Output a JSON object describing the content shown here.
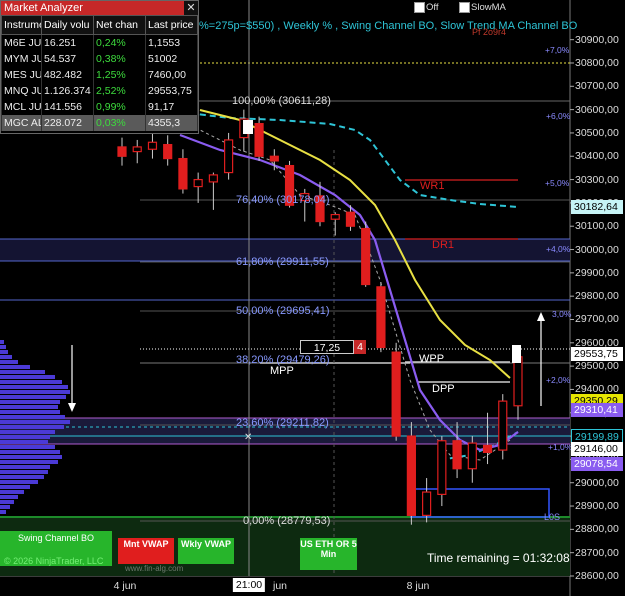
{
  "analyzer": {
    "title": "Market Analyzer",
    "close": "✕",
    "columns": [
      "Instrume",
      "Daily volu",
      "Net chan",
      "Last price"
    ],
    "rows": [
      {
        "instrument": "M6E JU",
        "volume": "16.251",
        "net": "0,24%",
        "last": "1,1553"
      },
      {
        "instrument": "MYM JU",
        "volume": "54.537",
        "net": "0,38%",
        "last": "51002"
      },
      {
        "instrument": "MES JU",
        "volume": "482.482",
        "net": "1,25%",
        "last": "7460,00"
      },
      {
        "instrument": "MNQ JU",
        "volume": "1.126.374",
        "net": "2,52%",
        "last": "29553,75"
      },
      {
        "instrument": "MCL JU",
        "volume": "141.556",
        "net": "0,99%",
        "last": "91,17"
      },
      {
        "instrument": "MGC AL",
        "volume": "228.072",
        "net": "0,03%",
        "last": "4355,3"
      }
    ]
  },
  "header": {
    "strip": "%=275p=$550) , Weekly % , Swing Channel BO, Slow Trend MA Channel BO",
    "off_label": "Off",
    "slowma_label": "SlowMA",
    "top_right_red": "Pf 2o9r4"
  },
  "price_axis": {
    "ticks": [
      "30900,00",
      "30800,00",
      "30700,00",
      "30600,00",
      "30500,00",
      "30400,00",
      "30300,00",
      "30200,00",
      "30100,00",
      "30000,00",
      "29900,00",
      "29800,00",
      "29700,00",
      "29600,00",
      "29500,00",
      "29400,00",
      "29300,00",
      "29200,00",
      "29100,00",
      "29000,00",
      "28900,00",
      "28800,00",
      "28700,00",
      "28600,00"
    ],
    "tags": [
      {
        "label": "30182,64",
        "bg": "#c6f4f6",
        "fg": "#000"
      },
      {
        "label": "29553,75",
        "bg": "#ffffff",
        "fg": "#000"
      },
      {
        "label": "29350,29",
        "bg": "#e6e600",
        "fg": "#000"
      },
      {
        "label": "29310,41",
        "bg": "#8a5cf0",
        "fg": "#fff"
      },
      {
        "label": "29199,89",
        "bg": "#000000",
        "fg": "#2ec4d6"
      },
      {
        "label": "29146,00",
        "bg": "#ffffff",
        "fg": "#000"
      },
      {
        "label": "29078,54",
        "bg": "#8a5cf0",
        "fg": "#fff"
      }
    ]
  },
  "weekly_pct": [
    "+7,0%",
    "+6,0%",
    "+5,0%",
    "+4,0%",
    "3,0%",
    "+2,0%",
    "+1,0%"
  ],
  "fib": [
    {
      "label": "100,00% (30611,28)"
    },
    {
      "label": "76,40% (30178,04)"
    },
    {
      "label": "61,80% (29911,55)"
    },
    {
      "label": "50,00% (29695,41)"
    },
    {
      "label": "38,20% (29479,26)"
    },
    {
      "label": "23,60% (29211,82)"
    },
    {
      "label": "0,00% (28779,53)"
    }
  ],
  "levels": {
    "wr1": "WR1",
    "dr1": "DR1",
    "wpp": "WPP",
    "dpp": "DPP",
    "mpp": "MPP",
    "l0s": "L0S"
  },
  "order": {
    "value": "17,25",
    "qty": "4"
  },
  "bottom": {
    "swing_channel": "Swing Channel BO",
    "mint_vwap": "Mnt VWAP",
    "wkly_vwap": "Wkly VWAP",
    "us_eth": "US ETH OR 5 Min",
    "copyright": "© 2026 NinjaTrader, LLC",
    "watermark": "www.fin-alg.com",
    "time_remaining": "Time remaining = 01:32:08"
  },
  "time_axis": {
    "labels": [
      {
        "text": "4 jun"
      },
      {
        "text": "21:00"
      },
      {
        "text": "jun"
      },
      {
        "text": "8 jun"
      }
    ]
  },
  "colors": {
    "fib": "#7b8cff",
    "cyan": "#2ec4d6",
    "yellow_ma": "#e8e043",
    "purple_ma": "#8a5cf0",
    "bear": "#e01e1e",
    "bull": "#e01e1e",
    "green_band": "#1d8a2a"
  },
  "chart_data": {
    "type": "candlestick",
    "ylim": [
      28600,
      30950
    ],
    "candles": [
      {
        "o": 30440,
        "h": 30480,
        "l": 30360,
        "c": 30400
      },
      {
        "o": 30420,
        "h": 30470,
        "l": 30370,
        "c": 30440
      },
      {
        "o": 30430,
        "h": 30500,
        "l": 30390,
        "c": 30460
      },
      {
        "o": 30450,
        "h": 30490,
        "l": 30360,
        "c": 30390
      },
      {
        "o": 30390,
        "h": 30430,
        "l": 30240,
        "c": 30260
      },
      {
        "o": 30270,
        "h": 30330,
        "l": 30200,
        "c": 30300
      },
      {
        "o": 30290,
        "h": 30330,
        "l": 30170,
        "c": 30320
      },
      {
        "o": 30330,
        "h": 30500,
        "l": 30300,
        "c": 30470
      },
      {
        "o": 30480,
        "h": 30600,
        "l": 30420,
        "c": 30560
      },
      {
        "o": 30540,
        "h": 30570,
        "l": 30380,
        "c": 30400
      },
      {
        "o": 30400,
        "h": 30430,
        "l": 30340,
        "c": 30380
      },
      {
        "o": 30360,
        "h": 30380,
        "l": 30180,
        "c": 30190
      },
      {
        "o": 30210,
        "h": 30260,
        "l": 30120,
        "c": 30240
      },
      {
        "o": 30230,
        "h": 30290,
        "l": 30100,
        "c": 30120
      },
      {
        "o": 30130,
        "h": 30160,
        "l": 30060,
        "c": 30150
      },
      {
        "o": 30160,
        "h": 30190,
        "l": 30080,
        "c": 30100
      },
      {
        "o": 30090,
        "h": 30120,
        "l": 29840,
        "c": 29850
      },
      {
        "o": 29840,
        "h": 29860,
        "l": 29560,
        "c": 29580
      },
      {
        "o": 29560,
        "h": 29600,
        "l": 29180,
        "c": 29200
      },
      {
        "o": 29200,
        "h": 29260,
        "l": 28820,
        "c": 28860
      },
      {
        "o": 28860,
        "h": 29020,
        "l": 28830,
        "c": 28960
      },
      {
        "o": 28950,
        "h": 29200,
        "l": 28900,
        "c": 29180
      },
      {
        "o": 29180,
        "h": 29260,
        "l": 29020,
        "c": 29060
      },
      {
        "o": 29060,
        "h": 29200,
        "l": 29000,
        "c": 29170
      },
      {
        "o": 29160,
        "h": 29300,
        "l": 29080,
        "c": 29130
      },
      {
        "o": 29140,
        "h": 29380,
        "l": 29100,
        "c": 29350
      },
      {
        "o": 29330,
        "h": 29560,
        "l": 29270,
        "c": 29540
      }
    ]
  }
}
